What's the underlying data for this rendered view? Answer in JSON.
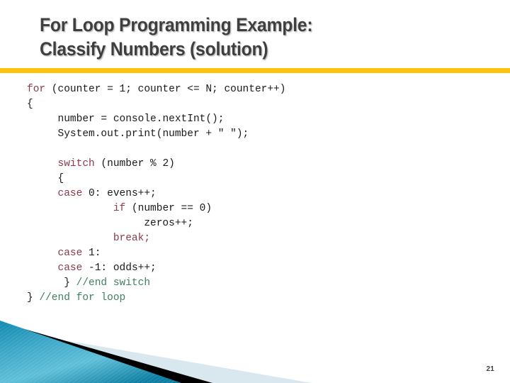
{
  "slide": {
    "page_number": "21",
    "accent_yellow": "#FFC20E",
    "title_color": "#3F3F3F",
    "background": "#FFFFFF"
  },
  "title": {
    "line1": "For Loop Programming Example:",
    "line2": "Classify Numbers (solution)"
  },
  "code": {
    "keyword_color": "#8B3A4A",
    "comment_color": "#3F7F5F",
    "text_color": "#1A1A1A",
    "lines": [
      {
        "indent": 0,
        "parts": [
          {
            "t": "for",
            "c": "kw"
          },
          {
            "t": " (counter = 1; counter <= N; counter++)",
            "c": "plain"
          }
        ]
      },
      {
        "indent": 0,
        "parts": [
          {
            "t": "{",
            "c": "plain"
          }
        ]
      },
      {
        "indent": 5,
        "parts": [
          {
            "t": "number = console.nextInt();",
            "c": "plain"
          }
        ]
      },
      {
        "indent": 5,
        "parts": [
          {
            "t": "System.out.print(number + \" \");",
            "c": "plain"
          }
        ]
      },
      {
        "indent": 0,
        "parts": [
          {
            "t": "",
            "c": "plain"
          }
        ]
      },
      {
        "indent": 5,
        "parts": [
          {
            "t": "switch",
            "c": "kw"
          },
          {
            "t": " (number % 2)",
            "c": "plain"
          }
        ]
      },
      {
        "indent": 5,
        "parts": [
          {
            "t": "{",
            "c": "plain"
          }
        ]
      },
      {
        "indent": 5,
        "parts": [
          {
            "t": "case",
            "c": "kw"
          },
          {
            "t": " 0: evens++;",
            "c": "plain"
          }
        ]
      },
      {
        "indent": 14,
        "parts": [
          {
            "t": "if",
            "c": "kw"
          },
          {
            "t": " (number == 0)",
            "c": "plain"
          }
        ]
      },
      {
        "indent": 19,
        "parts": [
          {
            "t": "zeros++;",
            "c": "plain"
          }
        ]
      },
      {
        "indent": 14,
        "parts": [
          {
            "t": "break;",
            "c": "kw"
          }
        ]
      },
      {
        "indent": 5,
        "parts": [
          {
            "t": "case",
            "c": "kw"
          },
          {
            "t": " 1:",
            "c": "plain"
          }
        ]
      },
      {
        "indent": 5,
        "parts": [
          {
            "t": "case",
            "c": "kw"
          },
          {
            "t": " -1: odds++;",
            "c": "plain"
          }
        ]
      },
      {
        "indent": 6,
        "parts": [
          {
            "t": "}",
            "c": "plain"
          },
          {
            "t": " //end switch",
            "c": "cmt"
          }
        ]
      },
      {
        "indent": 0,
        "parts": [
          {
            "t": "}",
            "c": "plain"
          },
          {
            "t": " //end for loop",
            "c": "cmt"
          }
        ]
      }
    ]
  },
  "decoration": {
    "blue_light": "#6CC3DD",
    "blue_dark": "#0E7FA3",
    "black": "#000000",
    "pale_blue": "#D9E8EE"
  }
}
